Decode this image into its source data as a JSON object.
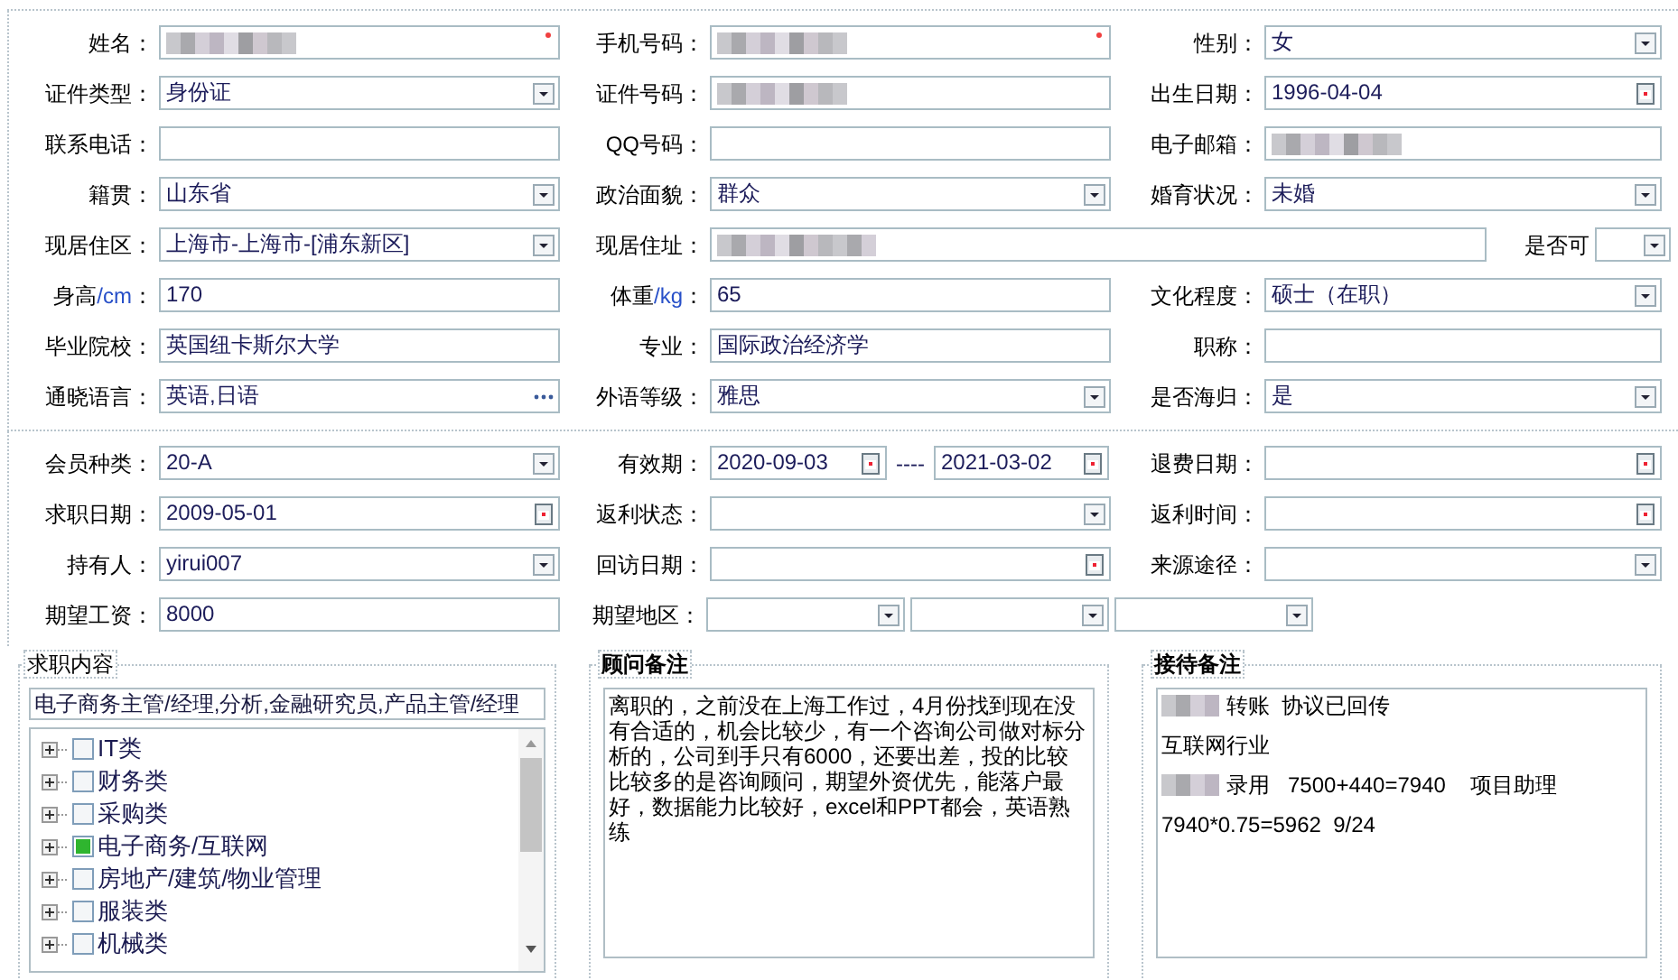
{
  "sections": [
    {
      "rows": [
        [
          {
            "label": "姓名：",
            "kind": "redacted",
            "required": true
          },
          {
            "label": "手机号码：",
            "kind": "redacted",
            "required": true
          },
          {
            "label": "性别：",
            "kind": "select",
            "value": "女"
          }
        ],
        [
          {
            "label": "证件类型：",
            "kind": "select",
            "value": "身份证"
          },
          {
            "label": "证件号码：",
            "kind": "redacted"
          },
          {
            "label": "出生日期：",
            "kind": "date",
            "value": "1996-04-04"
          }
        ],
        [
          {
            "label": "联系电话：",
            "kind": "text"
          },
          {
            "label": "QQ号码：",
            "kind": "text"
          },
          {
            "label": "电子邮箱：",
            "kind": "redacted"
          }
        ],
        [
          {
            "label": "籍贯：",
            "kind": "select",
            "value": "山东省"
          },
          {
            "label": "政治面貌：",
            "kind": "select",
            "value": "群众"
          },
          {
            "label": "婚育状况：",
            "kind": "select",
            "value": "未婚"
          }
        ],
        [
          {
            "label": "现居住区：",
            "kind": "select",
            "value": "上海市-上海市-[浦东新区]"
          },
          {
            "label": "现居住址：",
            "kind": "redacted_wide"
          },
          {
            "label": "是否可",
            "kind": "select_small"
          }
        ],
        [
          {
            "label": "身高",
            "unit": "/cm",
            "label_end": "：",
            "kind": "text",
            "value": "170"
          },
          {
            "label": "体重",
            "unit": "/kg",
            "label_end": "：",
            "kind": "text",
            "value": "65"
          },
          {
            "label": "文化程度：",
            "kind": "select",
            "value": "硕士（在职）"
          }
        ],
        [
          {
            "label": "毕业院校：",
            "kind": "text",
            "value": "英国纽卡斯尔大学"
          },
          {
            "label": "专业：",
            "kind": "text",
            "value": "国际政治经济学"
          },
          {
            "label": "职称：",
            "kind": "text"
          }
        ],
        [
          {
            "label": "通晓语言：",
            "kind": "picker",
            "value": "英语,日语"
          },
          {
            "label": "外语等级：",
            "kind": "select",
            "value": "雅思"
          },
          {
            "label": "是否海归：",
            "kind": "select",
            "value": "是"
          }
        ]
      ]
    },
    {
      "rows": [
        [
          {
            "label": "会员种类：",
            "kind": "select",
            "value": "20-A"
          },
          {
            "label": "有效期：",
            "kind": "date_range",
            "values": [
              "2020-09-03",
              "2021-03-02"
            ],
            "separator": "----"
          },
          {
            "label": "退费日期：",
            "kind": "date"
          }
        ],
        [
          {
            "label": "求职日期：",
            "kind": "date",
            "value": "2009-05-01"
          },
          {
            "label": "返利状态：",
            "kind": "select"
          },
          {
            "label": "返利时间：",
            "kind": "date"
          }
        ],
        [
          {
            "label": "持有人：",
            "kind": "select",
            "value": "yirui007"
          },
          {
            "label": "回访日期：",
            "kind": "date"
          },
          {
            "label": "来源途径：",
            "kind": "select"
          }
        ],
        [
          {
            "label": "期望工资：",
            "kind": "text",
            "value": "8000"
          },
          {
            "label": "期望地区：",
            "kind": "region"
          }
        ]
      ]
    }
  ],
  "job_panel": {
    "legend": "求职内容",
    "value": "电子商务主管/经理,分析,金融研究员,产品主管/经理",
    "tree": [
      {
        "label": "IT类",
        "checked": false,
        "expanded": false
      },
      {
        "label": "财务类",
        "checked": false,
        "expanded": false
      },
      {
        "label": "采购类",
        "checked": false,
        "expanded": false
      },
      {
        "label": "电子商务/互联网",
        "checked": true,
        "expanded": false
      },
      {
        "label": "房地产/建筑/物业管理",
        "checked": false,
        "expanded": false
      },
      {
        "label": "服装类",
        "checked": false,
        "expanded": false
      },
      {
        "label": "机械类",
        "checked": false,
        "expanded": false
      }
    ]
  },
  "advisor_panel": {
    "legend": "顾问备注",
    "text": "离职的，之前没在上海工作过，4月份找到现在没有合适的，机会比较少，有一个咨询公司做对标分析的，公司到手只有6000，还要出差，投的比较比较多的是咨询顾问，期望外资优先，能落户最好，数据能力比较好，excel和PPT都会，英语熟练"
  },
  "reception_panel": {
    "legend": "接待备注",
    "lines": [
      {
        "redacted": true,
        "text": "转账  协议已回传"
      },
      {
        "redacted": false,
        "text": "互联网行业"
      },
      {
        "redacted": true,
        "text": "录用   7500+440=7940    项目助理"
      },
      {
        "redacted": false,
        "text": "7940*0.75=5962  9/24"
      }
    ]
  }
}
